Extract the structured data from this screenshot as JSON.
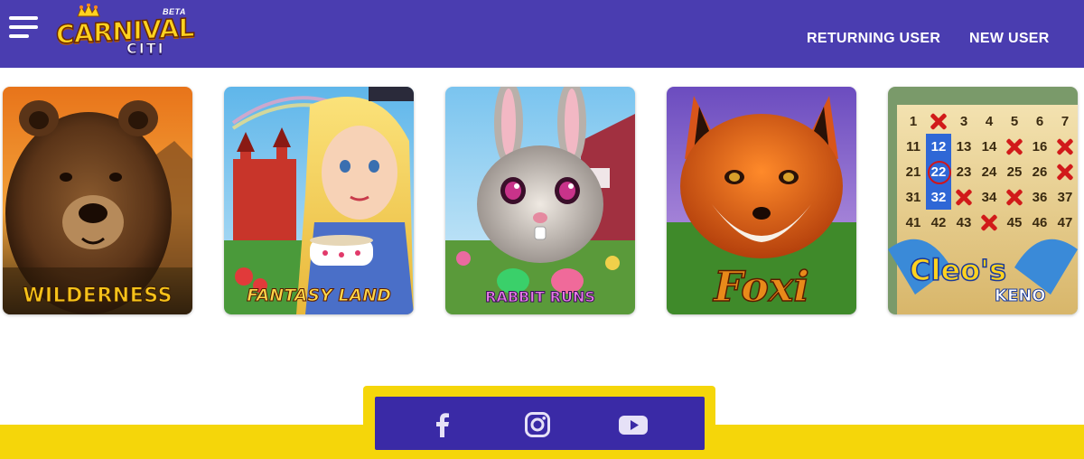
{
  "header": {
    "logo": {
      "word1": "CARNIVAL",
      "word2": "CITI",
      "badge": "BETA"
    },
    "nav": {
      "returning_user": "RETURNING USER",
      "new_user": "NEW USER"
    }
  },
  "games": [
    {
      "title": "WILDERNESS"
    },
    {
      "title": "FANTASY LAND"
    },
    {
      "title": "RABBIT RUNS"
    },
    {
      "title": "Foxi"
    },
    {
      "title": "Cleo's",
      "subtitle": "KENO"
    }
  ],
  "keno_board": {
    "rows": [
      [
        "1",
        "",
        "3",
        "4",
        "5",
        "6",
        "7"
      ],
      [
        "11",
        "12",
        "13",
        "14",
        "",
        "16",
        ""
      ],
      [
        "21",
        "22",
        "23",
        "24",
        "25",
        "26",
        ""
      ],
      [
        "31",
        "32",
        "",
        "34",
        "",
        "36",
        "37"
      ],
      [
        "41",
        "42",
        "43",
        "",
        "45",
        "46",
        "47"
      ]
    ]
  },
  "footer": {
    "social": [
      "facebook-icon",
      "instagram-icon",
      "youtube-icon"
    ]
  },
  "colors": {
    "header_bg": "#4a3db0",
    "footer_yellow": "#f5d60a",
    "social_bg": "#3a2aa6"
  }
}
